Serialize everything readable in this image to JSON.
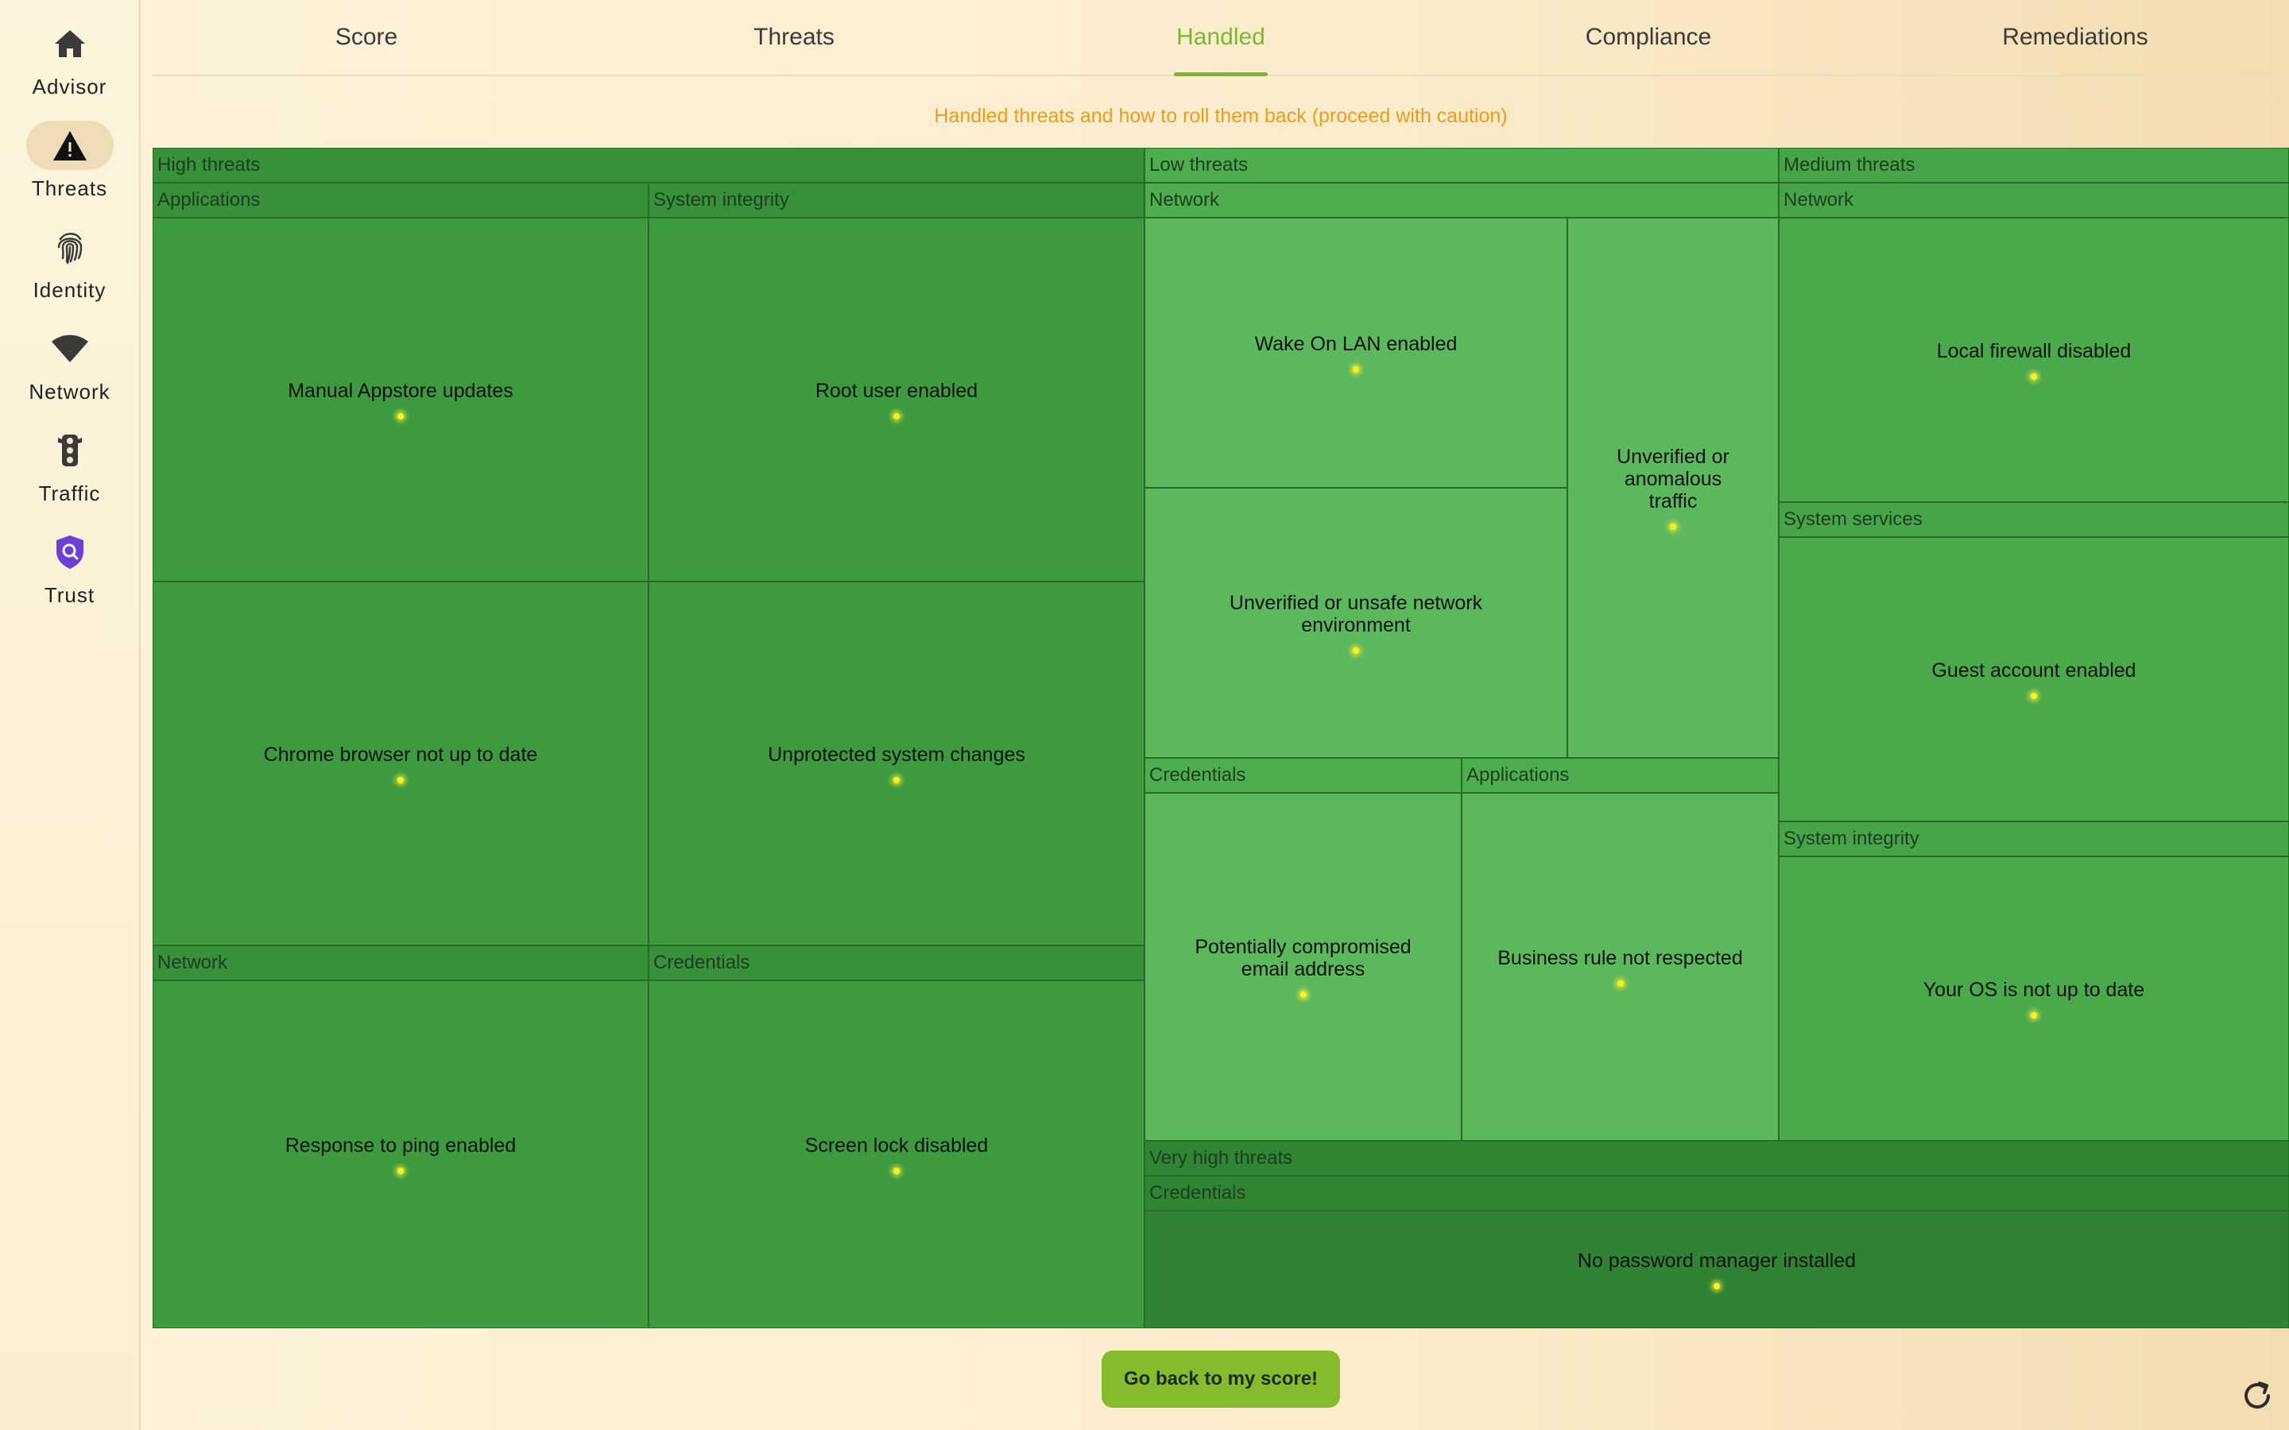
{
  "sidebar": {
    "items": [
      {
        "label": "Advisor",
        "icon": "home-icon"
      },
      {
        "label": "Threats",
        "icon": "warning-icon"
      },
      {
        "label": "Identity",
        "icon": "fingerprint-icon"
      },
      {
        "label": "Network",
        "icon": "wifi-icon"
      },
      {
        "label": "Traffic",
        "icon": "traffic-light-icon"
      },
      {
        "label": "Trust",
        "icon": "shield-search-icon"
      }
    ],
    "active": "Threats"
  },
  "tabs": [
    {
      "label": "Score"
    },
    {
      "label": "Threats"
    },
    {
      "label": "Handled"
    },
    {
      "label": "Compliance"
    },
    {
      "label": "Remediations"
    }
  ],
  "active_tab": "Handled",
  "subtitle": "Handled threats and how to roll them back (proceed with caution)",
  "treemap": {
    "high": {
      "label": "High threats",
      "applications": {
        "label": "Applications",
        "items": [
          "Manual Appstore updates",
          "Chrome browser not up to date"
        ]
      },
      "system_integrity": {
        "label": "System integrity",
        "items": [
          "Root user enabled",
          "Unprotected system changes"
        ]
      },
      "network": {
        "label": "Network",
        "items": [
          "Response to ping enabled"
        ]
      },
      "credentials": {
        "label": "Credentials",
        "items": [
          "Screen lock disabled"
        ]
      }
    },
    "low": {
      "label": "Low threats",
      "network": {
        "label": "Network",
        "items": [
          "Wake On LAN enabled",
          "Unverified or unsafe network environment",
          "Unverified or anomalous traffic"
        ]
      },
      "credentials": {
        "label": "Credentials",
        "items": [
          "Potentially compromised email address"
        ]
      },
      "applications": {
        "label": "Applications",
        "items": [
          "Business rule not respected"
        ]
      }
    },
    "medium": {
      "label": "Medium threats",
      "network": {
        "label": "Network",
        "items": [
          "Local firewall disabled"
        ]
      },
      "system_services": {
        "label": "System services",
        "items": [
          "Guest account enabled"
        ]
      },
      "system_integrity": {
        "label": "System integrity",
        "items": [
          "Your OS is not up to date"
        ]
      }
    },
    "very_high": {
      "label": "Very high threats",
      "credentials": {
        "label": "Credentials",
        "items": [
          "No password manager installed"
        ]
      }
    }
  },
  "back_button": "Go back to my score!",
  "colors": {
    "accent": "#7cb82f",
    "subtitle": "#f19b1c",
    "button": "#86bb2e"
  }
}
